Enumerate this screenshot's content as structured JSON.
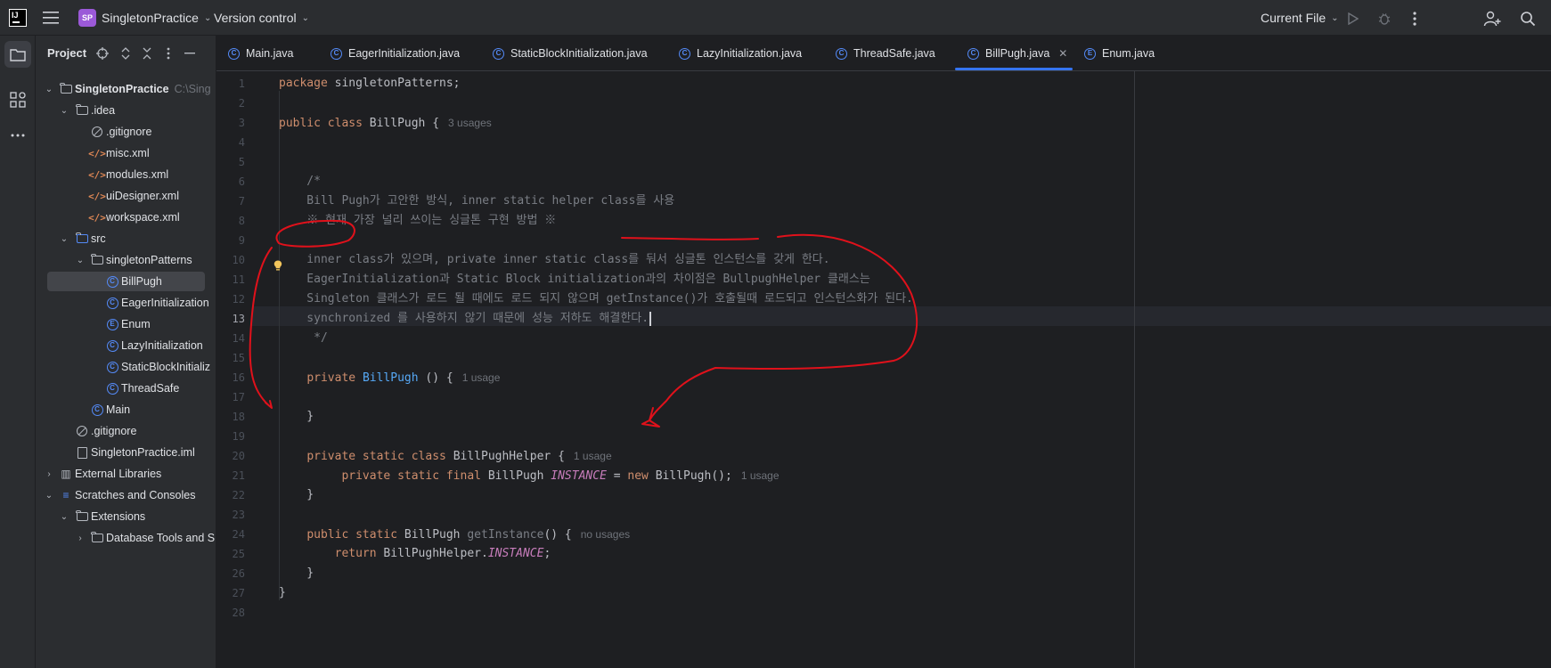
{
  "titlebar": {
    "logo_text": "IJ",
    "project_badge": "SP",
    "project_name": "SingletonPractice",
    "vcs_label": "Version control",
    "run_config": "Current File"
  },
  "project_panel": {
    "title": "Project",
    "tree": [
      {
        "label": "SingletonPractice",
        "suffix": "C:\\Sing",
        "icon": "module-folder-icon",
        "expanded": true
      },
      {
        "label": ".idea",
        "icon": "folder-icon",
        "expanded": true
      },
      {
        "label": ".gitignore",
        "icon": "ignore-file-icon"
      },
      {
        "label": "misc.xml",
        "icon": "xml-file-icon"
      },
      {
        "label": "modules.xml",
        "icon": "xml-file-icon"
      },
      {
        "label": "uiDesigner.xml",
        "icon": "xml-file-icon"
      },
      {
        "label": "workspace.xml",
        "icon": "xml-file-icon"
      },
      {
        "label": "src",
        "icon": "source-folder-icon",
        "expanded": true
      },
      {
        "label": "singletonPatterns",
        "icon": "package-icon",
        "expanded": true
      },
      {
        "label": "BillPugh",
        "icon": "class-icon",
        "selected": true
      },
      {
        "label": "EagerInitialization",
        "icon": "class-icon"
      },
      {
        "label": "Enum",
        "icon": "enum-icon"
      },
      {
        "label": "LazyInitialization",
        "icon": "class-icon"
      },
      {
        "label": "StaticBlockInitializ",
        "icon": "class-icon"
      },
      {
        "label": "ThreadSafe",
        "icon": "class-icon"
      },
      {
        "label": "Main",
        "icon": "main-class-icon"
      },
      {
        "label": ".gitignore",
        "icon": "ignore-file-icon"
      },
      {
        "label": "SingletonPractice.iml",
        "icon": "iml-file-icon"
      },
      {
        "label": "External Libraries",
        "icon": "library-icon",
        "expanded": false
      },
      {
        "label": "Scratches and Consoles",
        "icon": "scratches-icon",
        "expanded": true
      },
      {
        "label": "Extensions",
        "icon": "folder-icon",
        "expanded": true
      },
      {
        "label": "Database Tools and S",
        "icon": "folder-icon",
        "expanded": false
      }
    ]
  },
  "tabs": [
    {
      "label": "Main.java",
      "icon": "main-class-icon"
    },
    {
      "label": "EagerInitialization.java",
      "icon": "class-icon"
    },
    {
      "label": "StaticBlockInitialization.java",
      "icon": "class-icon"
    },
    {
      "label": "LazyInitialization.java",
      "icon": "class-icon"
    },
    {
      "label": "ThreadSafe.java",
      "icon": "class-icon"
    },
    {
      "label": "BillPugh.java",
      "icon": "class-icon",
      "active": true
    },
    {
      "label": "Enum.java",
      "icon": "enum-icon"
    }
  ],
  "editor": {
    "current_line": 13,
    "line_numbers": [
      "1",
      "2",
      "3",
      "4",
      "5",
      "6",
      "7",
      "8",
      "9",
      "10",
      "11",
      "12",
      "13",
      "14",
      "15",
      "16",
      "17",
      "18",
      "19",
      "20",
      "21",
      "22",
      "23",
      "24",
      "25",
      "26",
      "27",
      "28"
    ],
    "code": {
      "l1_kw": "package",
      "l1_rest": " singletonPatterns;",
      "l3_kw1": "public",
      "l3_kw2": "class",
      "l3_cls": "BillPugh",
      "l3_brace": " {",
      "l3_hint": "3 usages",
      "l6": "    /*",
      "l7": "    Bill Pugh가 고안한 방식, inner static helper class를 사용",
      "l8": "    ※ 현재 가장 널리 쓰이는 싱글톤 구현 방법 ※",
      "l10": "    inner class가 있으며, private inner static class를 둬서 싱글톤 인스턴스를 갖게 한다.",
      "l11": "    EagerInitialization과 Static Block initialization과의 차이점은 BullpughHelper 클래스는",
      "l12": "    Singleton 클래스가 로드 될 때에도 로드 되지 않으며 getInstance()가 호출될때 로드되고 인스턴스화가 된다.",
      "l13": "    synchronized 를 사용하지 않기 때문에 성능 저하도 해결한다.",
      "l14": "     */",
      "l16_kw": "private",
      "l16_fn": "BillPugh",
      "l16_rest": " () {",
      "l16_hint": "1 usage",
      "l18": "    }",
      "l20_kw": "private static class",
      "l20_cls": "BillPughHelper",
      "l20_rest": " {",
      "l20_hint": "1 usage",
      "l21_kw": "private static final",
      "l21_cls": "BillPugh",
      "l21_st": "INSTANCE",
      "l21_eq": " = ",
      "l21_new": "new",
      "l21_call": "BillPugh",
      "l21_end": "();",
      "l21_hint": "1 usage",
      "l22": "    }",
      "l24_kw": "public static",
      "l24_cls": "BillPugh",
      "l24_fn": "getInstance",
      "l24_rest": "() {",
      "l24_hint": "no usages",
      "l25_kw": "return",
      "l25_cls": "BillPughHelper.",
      "l25_st": "INSTANCE",
      "l25_end": ";",
      "l26": "    }",
      "l27": "}"
    }
  },
  "colors": {
    "accent": "#3574f0",
    "keyword": "#cf8e6d",
    "function": "#56a8f5",
    "static_field": "#c77dbb",
    "comment": "#7a7e85",
    "annotation_ink": "#e0111b"
  }
}
